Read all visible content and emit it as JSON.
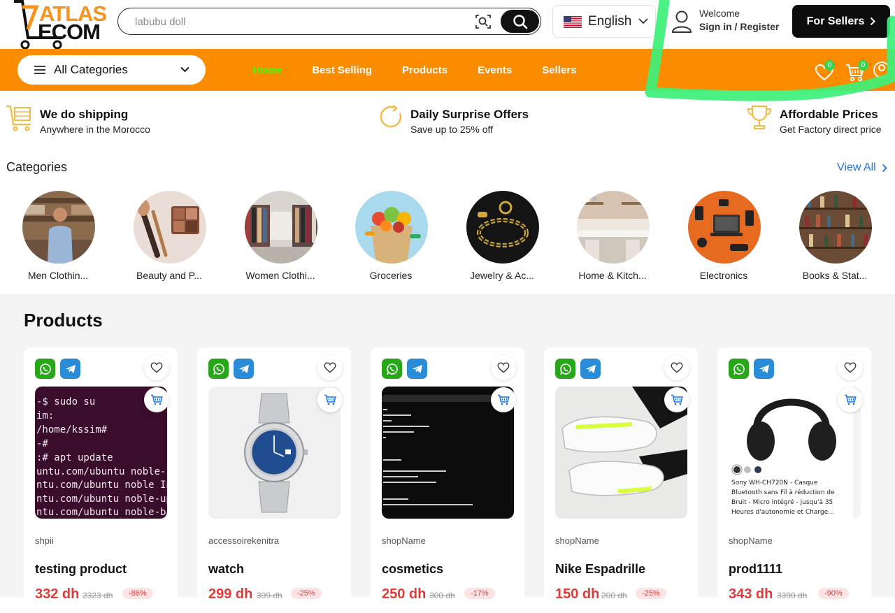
{
  "brand": {
    "line1": "ATLAS",
    "line2": "ECOM",
    "accent": "#f7931e"
  },
  "search": {
    "placeholder": "labubu doll",
    "scan_icon": "image-search-icon",
    "button_icon": "search-icon"
  },
  "language": {
    "label": "English",
    "flag": "us-flag-icon"
  },
  "account": {
    "welcome": "Welcome",
    "signin": "Sign in / Register"
  },
  "sellers_button": {
    "label": "For Sellers"
  },
  "nav": {
    "categories_label": "All Categories",
    "links": [
      {
        "label": "Home",
        "active": true
      },
      {
        "label": "Best Selling",
        "active": false
      },
      {
        "label": "Products",
        "active": false
      },
      {
        "label": "Events",
        "active": false
      },
      {
        "label": "Sellers",
        "active": false
      }
    ],
    "wishlist_count": "0",
    "cart_count": "0",
    "bar_color": "#fb8c00",
    "active_color": "#39ff14"
  },
  "features": [
    {
      "title": "We do shipping",
      "subtitle": "Anywhere in the Morocco",
      "icon": "shipping-cart-icon"
    },
    {
      "title": "Daily Surprise Offers",
      "subtitle": "Save up to 25% off",
      "icon": "refresh-offer-icon"
    },
    {
      "title": "Affordable Prices",
      "subtitle": "Get Factory direct price",
      "icon": "trophy-icon"
    }
  ],
  "categories": {
    "heading": "Categories",
    "view_all": "View All",
    "items": [
      {
        "label": "Men Clothin..."
      },
      {
        "label": "Beauty and P..."
      },
      {
        "label": "Women Clothi..."
      },
      {
        "label": "Groceries"
      },
      {
        "label": "Jewelry & Ac..."
      },
      {
        "label": "Home & Kitch..."
      },
      {
        "label": "Electronics"
      },
      {
        "label": "Books & Stat..."
      }
    ]
  },
  "products": {
    "heading": "Products",
    "items": [
      {
        "shop": "shpii",
        "name": "testing product",
        "price": "332 dh",
        "old_price": "2323 dh",
        "discount": "-86%"
      },
      {
        "shop": "accessoirekenitra",
        "name": "watch",
        "price": "299 dh",
        "old_price": "399 dh",
        "discount": "-25%"
      },
      {
        "shop": "shopName",
        "name": "cosmetics",
        "price": "250 dh",
        "old_price": "300 dh",
        "discount": "-17%"
      },
      {
        "shop": "shopName",
        "name": "Nike Espadrille",
        "price": "150 dh",
        "old_price": "200 dh",
        "discount": "-25%"
      },
      {
        "shop": "shopName",
        "name": "prod1111",
        "price": "343 dh",
        "old_price": "3390 dh",
        "discount": "-90%"
      }
    ],
    "image_texts": {
      "terminal": [
        "-$ sudo su",
        "im:",
        "/home/kssim#",
        "-#",
        ":# apt update",
        "untu.com/ubuntu noble-secui",
        "ntu.com/ubuntu noble InRele",
        "ntu.com/ubuntu noble-update",
        "ntu.com/ubuntu noble-backpo"
      ],
      "headphones_caption": "Sony WH-CH720N - Casque Bluetooth sans Fil à réduction de Bruit - Micro intégré - jusqu'à 35 Heures d'autonomie et Charge..."
    }
  }
}
